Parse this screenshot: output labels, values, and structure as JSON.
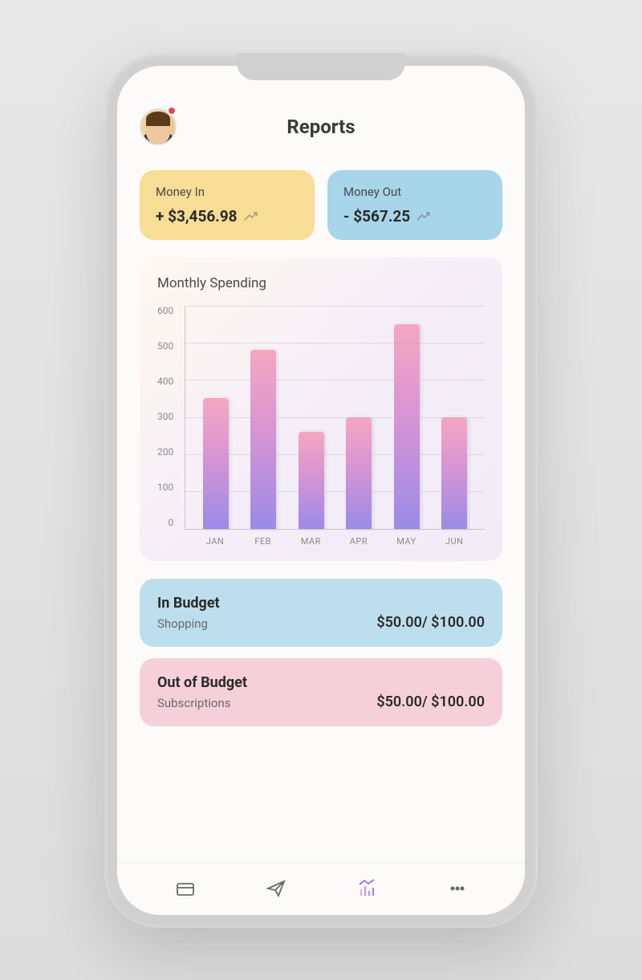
{
  "header": {
    "title": "Reports"
  },
  "summary": {
    "money_in": {
      "label": "Money In",
      "value": "+ $3,456.98"
    },
    "money_out": {
      "label": "Money Out",
      "value": "- $567.25"
    }
  },
  "chart": {
    "title": "Monthly Spending"
  },
  "chart_data": {
    "type": "bar",
    "title": "Monthly Spending",
    "categories": [
      "JAN",
      "FEB",
      "MAR",
      "APR",
      "MAY",
      "JUN"
    ],
    "values": [
      350,
      480,
      260,
      300,
      550,
      300
    ],
    "ylabel": "",
    "xlabel": "",
    "ylim": [
      0,
      600
    ],
    "y_ticks": [
      600,
      500,
      400,
      300,
      200,
      100,
      0
    ]
  },
  "budgets": {
    "in_budget": {
      "title": "In Budget",
      "category": "Shopping",
      "amount": "$50.00/ $100.00"
    },
    "out_budget": {
      "title": "Out of Budget",
      "category": "Subscriptions",
      "amount": "$50.00/ $100.00"
    }
  },
  "colors": {
    "money_in_bg": "#f7dd95",
    "money_out_bg": "#a7d5ea",
    "in_budget_bg": "#bddfed",
    "out_budget_bg": "#f5d0da",
    "accent": "#a070d8"
  }
}
